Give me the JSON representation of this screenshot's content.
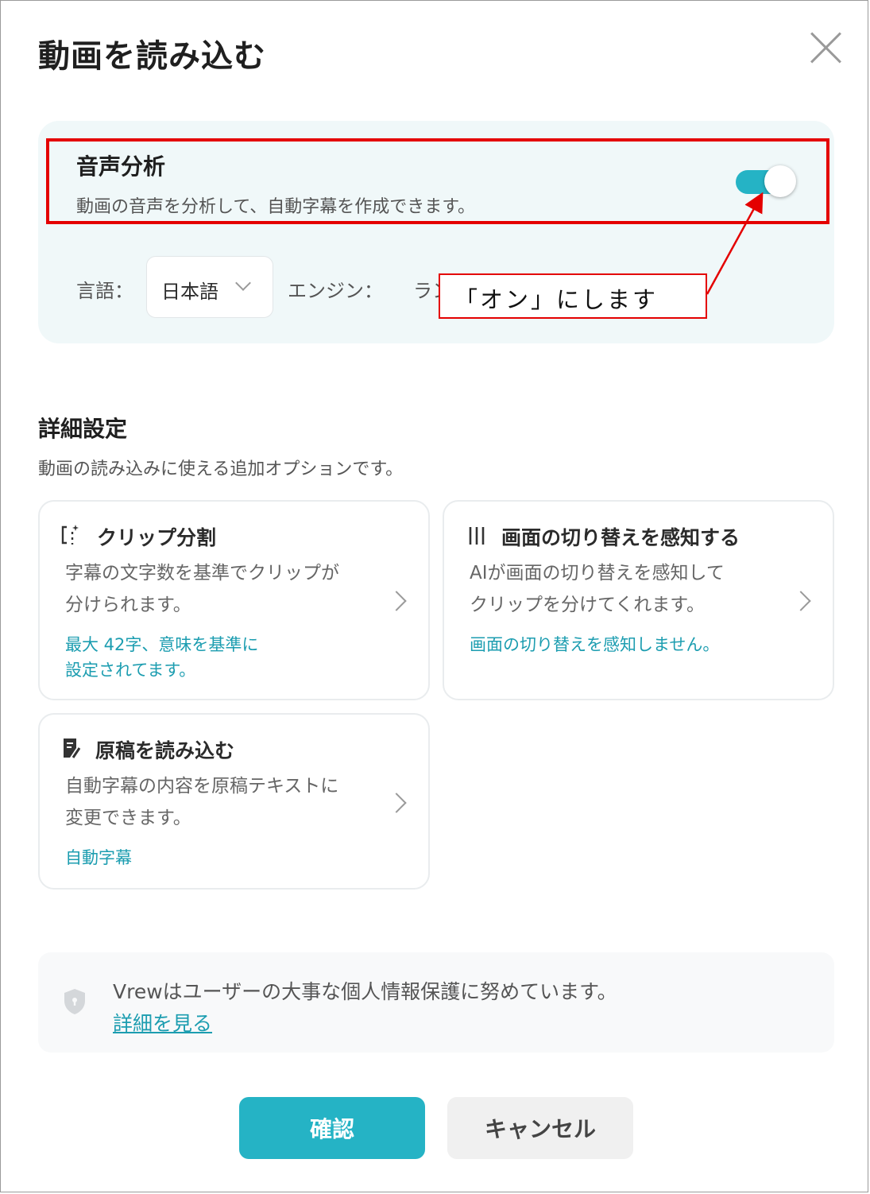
{
  "dialog": {
    "title": "動画を読み込む"
  },
  "voice_analysis": {
    "title": "音声分析",
    "description": "動画の音声を分析して、自動字幕を作成できます。",
    "toggle_on": true,
    "language_label": "言語：",
    "language_value": "日本語",
    "engine_label": "エンジン：",
    "engine_value": "ラン",
    "accent_color": "#25b3c5"
  },
  "annotation": {
    "callout_text": "「オン」にします",
    "color": "#e40000"
  },
  "advanced": {
    "title": "詳細設定",
    "description": "動画の読み込みに使える追加オプションです。",
    "cards": [
      {
        "icon": "clip-split-icon",
        "title": "クリップ分割",
        "description": "字幕の文字数を基準でクリップが\n分けられます。",
        "status": "最大 42字、意味を基準に\n設定されてます。"
      },
      {
        "icon": "scene-detect-icon",
        "title": "画面の切り替えを感知する",
        "description": "AIが画面の切り替えを感知して\nクリップを分けてくれます。",
        "status": "画面の切り替えを感知しません。"
      },
      {
        "icon": "script-icon",
        "title": "原稿を読み込む",
        "description": "自動字幕の内容を原稿テキストに\n変更できます。",
        "status": "自動字幕"
      }
    ]
  },
  "privacy": {
    "text": "Vrewはユーザーの大事な個人情報保護に努めています。",
    "link": "詳細を見る"
  },
  "buttons": {
    "confirm": "確認",
    "cancel": "キャンセル"
  }
}
